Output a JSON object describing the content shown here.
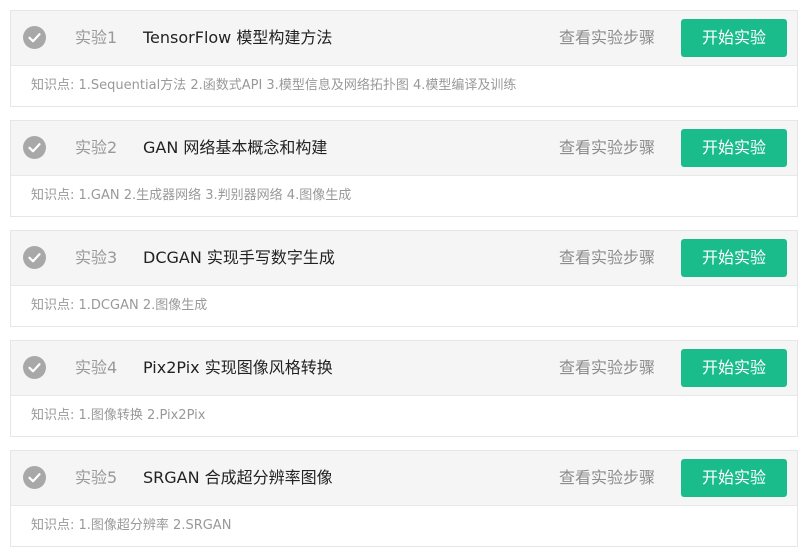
{
  "colors": {
    "accent_green": "#1abc8c",
    "check_gray": "#a8a8a8",
    "header_bg": "#f5f5f5"
  },
  "icons": {
    "check": "check-circle-icon"
  },
  "labs": [
    {
      "num": "实验1",
      "title": "TensorFlow 模型构建方法",
      "view_steps": "查看实验步骤",
      "start": "开始实验",
      "knowledge": "知识点: 1.Sequential方法 2.函数式API 3.模型信息及网络拓扑图 4.模型编译及训练"
    },
    {
      "num": "实验2",
      "title": "GAN 网络基本概念和构建",
      "view_steps": "查看实验步骤",
      "start": "开始实验",
      "knowledge": "知识点: 1.GAN 2.生成器网络 3.判别器网络 4.图像生成"
    },
    {
      "num": "实验3",
      "title": "DCGAN 实现手写数字生成",
      "view_steps": "查看实验步骤",
      "start": "开始实验",
      "knowledge": "知识点: 1.DCGAN 2.图像生成"
    },
    {
      "num": "实验4",
      "title": "Pix2Pix 实现图像风格转换",
      "view_steps": "查看实验步骤",
      "start": "开始实验",
      "knowledge": "知识点: 1.图像转换 2.Pix2Pix"
    },
    {
      "num": "实验5",
      "title": "SRGAN 合成超分辨率图像",
      "view_steps": "查看实验步骤",
      "start": "开始实验",
      "knowledge": "知识点: 1.图像超分辨率 2.SRGAN"
    }
  ]
}
